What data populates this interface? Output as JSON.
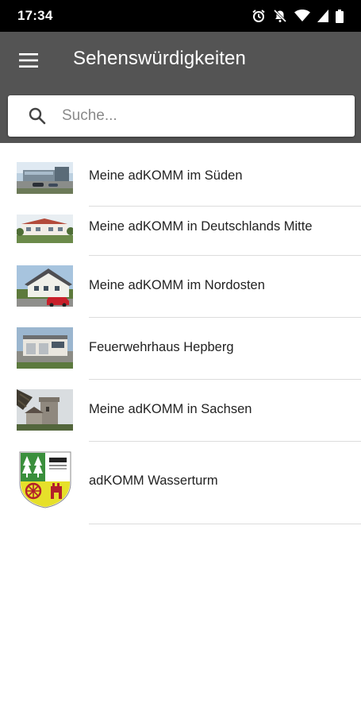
{
  "status_bar": {
    "time": "17:34",
    "icons": [
      "alarm-icon",
      "notifications-off-icon",
      "wifi-icon",
      "signal-icon",
      "battery-icon"
    ]
  },
  "app_bar": {
    "menu_icon": "hamburger-menu-icon",
    "title": "Sehenswürdigkeiten"
  },
  "search": {
    "icon": "search-icon",
    "placeholder": "Suche..."
  },
  "list": {
    "items": [
      {
        "label": "Meine adKOMM im Süden",
        "thumbnail": "office-building-photo"
      },
      {
        "label": "Meine adKOMM in Deutschlands Mitte",
        "thumbnail": "white-building-photo"
      },
      {
        "label": "Meine adKOMM im Nordosten",
        "thumbnail": "house-with-car-photo"
      },
      {
        "label": "Feuerwehrhaus Hepberg",
        "thumbnail": "fire-station-photo"
      },
      {
        "label": "Meine adKOMM in Sachsen",
        "thumbnail": "castle-tower-photo"
      },
      {
        "label": "adKOMM Wasserturm",
        "thumbnail": "coat-of-arms-logo"
      }
    ]
  },
  "colors": {
    "app_bar": "#545454",
    "status_bar": "#000000",
    "background": "#ffffff",
    "divider": "#dcdcdc"
  }
}
